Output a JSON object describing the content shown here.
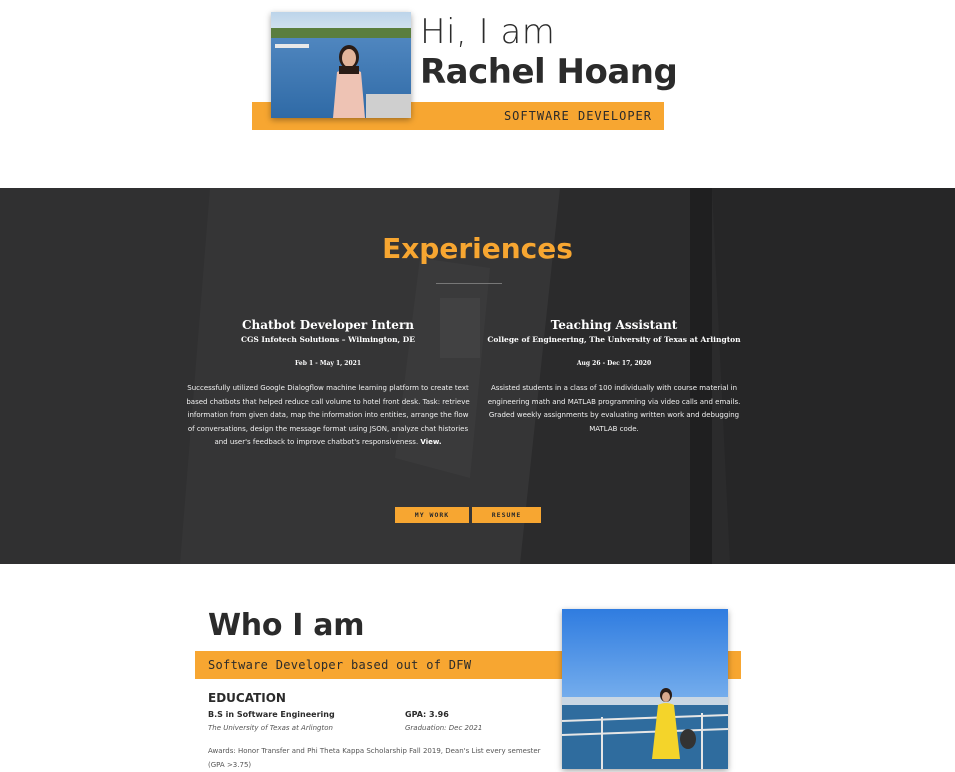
{
  "hero": {
    "greeting": "Hi, I am",
    "name": "Rachel Hoang",
    "role": "SOFTWARE DEVELOPER",
    "accent_color": "#f7a631"
  },
  "experiences": {
    "title": "Experiences",
    "jobs": [
      {
        "title": "Chatbot Developer Intern",
        "organization": "CGS Infotech Solutions – Wilmington, DE",
        "dates": "Feb 1 - May 1, 2021",
        "description": "Successfully utilized Google Dialogflow machine learning platform to create text based chatbots that helped reduce call volume to hotel front desk. Task: retrieve information from given data, map the information into entities, arrange the flow of conversations, design the message format using JSON, analyze chat histories and user's feedback to improve chatbot's responsiveness.",
        "link": "View."
      },
      {
        "title": "Teaching Assistant",
        "organization": "College of Engineering, The University of Texas at Arlington",
        "dates": "Aug 26 - Dec 17, 2020",
        "description": "Assisted students in a class of 100 individually with course material in engineering math and MATLAB programming via video calls and emails. Graded weekly assignments by evaluating written work and debugging MATLAB code."
      }
    ],
    "buttons": {
      "my_work": "MY WORK",
      "resume": "RESUME"
    }
  },
  "who": {
    "title": "Who I am",
    "subtitle": "Software Developer based out of DFW",
    "education": {
      "heading": "EDUCATION",
      "degree": "B.S in Software Engineering",
      "school": "The University of Texas at Arlington",
      "gpa": "GPA: 3.96",
      "graduation": "Graduation: Dec 2021",
      "awards": "Awards: Honor Transfer and Phi Theta Kappa Scholarship Fall 2019, Dean's List every semester (GPA >3.75)"
    }
  }
}
